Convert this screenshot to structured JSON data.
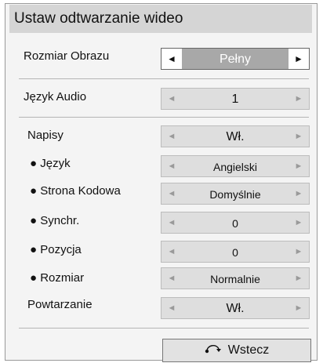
{
  "dialog": {
    "title": "Ustaw odtwarzanie wideo"
  },
  "settings": [
    {
      "label": "Rozmiar Obrazu",
      "value": "Pełny"
    },
    {
      "label": "Język Audio",
      "value": "1"
    },
    {
      "label": "Napisy",
      "value": "Wł."
    },
    {
      "label": "● Język",
      "value": "Angielski"
    },
    {
      "label": "● Strona Kodowa",
      "value": "Domyślnie"
    },
    {
      "label": "● Synchr.",
      "value": "0"
    },
    {
      "label": "● Pozycja",
      "value": "0"
    },
    {
      "label": "● Rozmiar",
      "value": "Normalnie"
    },
    {
      "label": "Powtarzanie",
      "value": "Wł."
    }
  ],
  "arrows": {
    "left": "◄",
    "right": "►"
  },
  "footer": {
    "back_label": "Wstecz",
    "back_icon": "return-arrow-icon"
  }
}
